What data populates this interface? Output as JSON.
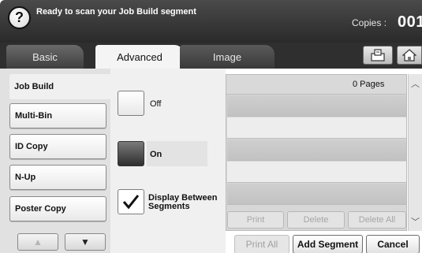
{
  "header": {
    "status_text": "Ready to scan your Job Build segment",
    "copies_label": "Copies :",
    "copies_value": "001"
  },
  "tabs": [
    {
      "label": "Basic"
    },
    {
      "label": "Advanced"
    },
    {
      "label": "Image"
    }
  ],
  "sidebar": {
    "items": [
      {
        "label": "Job Build"
      },
      {
        "label": "Multi-Bin"
      },
      {
        "label": "ID Copy"
      },
      {
        "label": "N-Up"
      },
      {
        "label": "Poster Copy"
      }
    ]
  },
  "options": {
    "off_label": "Off",
    "on_label": "On",
    "display_between_label_1": "Display Between",
    "display_between_label_2": "Segments",
    "display_between_checked": true,
    "selected": "On"
  },
  "segments": {
    "pages_label": "0 Pages",
    "print_label": "Print",
    "delete_label": "Delete",
    "delete_all_label": "Delete All"
  },
  "footer": {
    "print_all_label": "Print All",
    "add_segment_label": "Add Segment",
    "cancel_label": "Cancel"
  },
  "icons": {
    "help": "question-icon",
    "job_status": "tray-icon",
    "home": "home-icon",
    "up": "arrow-up-icon",
    "down": "arrow-down-icon"
  }
}
